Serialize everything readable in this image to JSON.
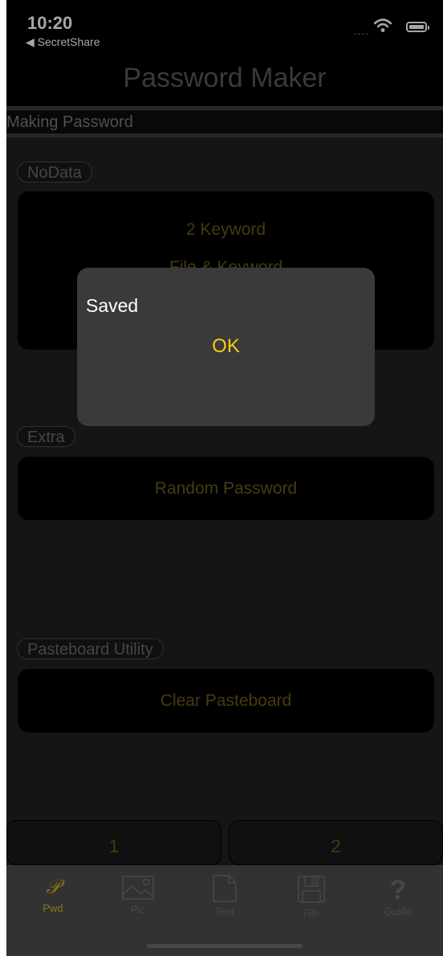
{
  "status_bar": {
    "time": "10:20",
    "back_app": "◀ SecretShare",
    "signal": "....",
    "wifi_icon": "wifi-icon",
    "battery_icon": "battery-icon"
  },
  "nav": {
    "title": "Password Maker"
  },
  "section": {
    "title": "Making Password"
  },
  "groups": {
    "nodata": {
      "label": "NoData",
      "buttons": [
        "2 Keyword",
        "File & Keyword"
      ]
    },
    "extra": {
      "label": "Extra",
      "button": "Random Password"
    },
    "pasteboard": {
      "label": "Pasteboard Utility",
      "button": "Clear Pasteboard"
    }
  },
  "bottom_buttons": [
    "1",
    "2"
  ],
  "tabbar": {
    "items": [
      {
        "label": "Pwd",
        "icon": "script-p-icon",
        "active": true
      },
      {
        "label": "Pic",
        "icon": "picture-icon",
        "active": false
      },
      {
        "label": "Text",
        "icon": "document-icon",
        "active": false
      },
      {
        "label": "File",
        "icon": "floppy-disk-icon",
        "active": false
      },
      {
        "label": "Guide",
        "icon": "question-mark-icon",
        "active": false
      }
    ]
  },
  "alert": {
    "message": "Saved",
    "ok_label": "OK"
  },
  "colors": {
    "accent": "#f3cd16",
    "dim_accent": "#6b5b1a",
    "background": "#212121",
    "panel": "#000000",
    "tabbar": "#4d4d4d"
  }
}
